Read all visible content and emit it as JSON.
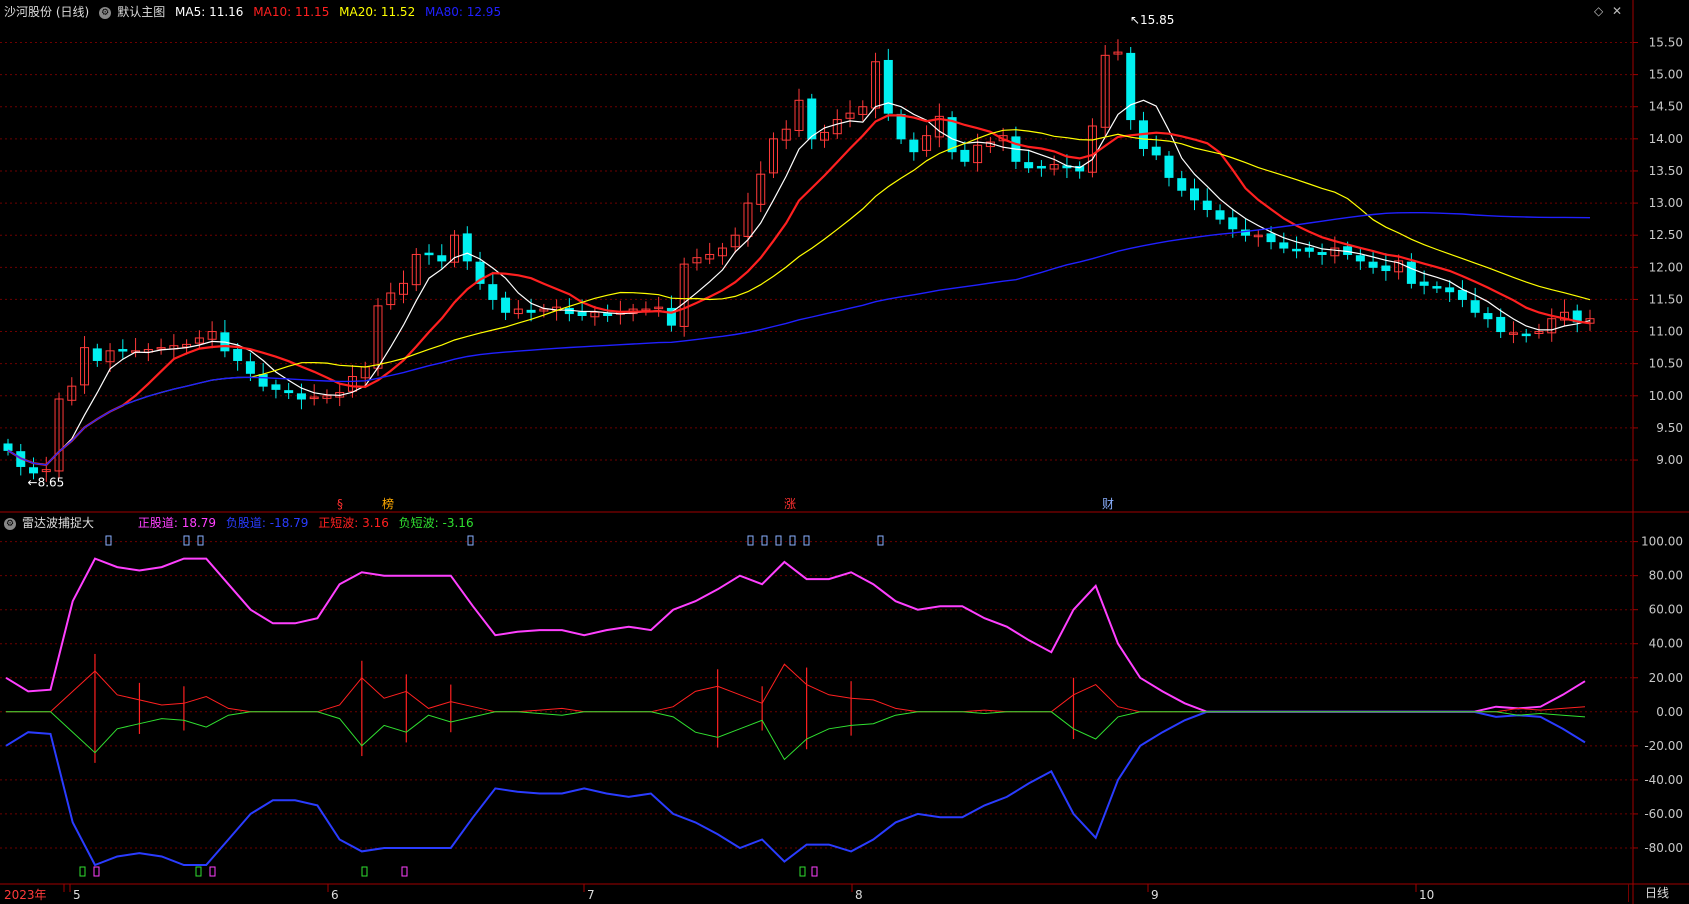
{
  "window": {
    "stock_title": "沙河股份 (日线)",
    "main_indicator": "默认主图",
    "diamond_icon": "diamond-icon",
    "close_icon": "close-icon"
  },
  "ma_legend": [
    {
      "label": "MA5: 11.16",
      "color": "#ffffff"
    },
    {
      "label": "MA10: 11.15",
      "color": "#ff2020"
    },
    {
      "label": "MA20: 11.52",
      "color": "#ffff00"
    },
    {
      "label": "MA80: 12.95",
      "color": "#2020ff"
    }
  ],
  "sub_legend": {
    "title": "雷达波捕捉大",
    "items": [
      {
        "label": "正股道: 18.79",
        "color": "#ff40ff"
      },
      {
        "label": "负股道: -18.79",
        "color": "#2a3cff"
      },
      {
        "label": "正短波: 3.16",
        "color": "#ff2020"
      },
      {
        "label": "负短波: -3.16",
        "color": "#30e030"
      }
    ]
  },
  "period_label": "日线",
  "colors": {
    "up": "#ff3a3a",
    "down": "#00f0f0",
    "grid": "#6e0000",
    "axis_text": "#c8c8c8"
  },
  "chart_data": [
    {
      "type": "candlestick",
      "title": "沙河股份 (日线)",
      "yticks": [
        9.0,
        9.5,
        10.0,
        10.5,
        11.0,
        11.5,
        12.0,
        12.5,
        13.0,
        13.5,
        14.0,
        14.5,
        15.0,
        15.5
      ],
      "ylim": [
        8.3,
        15.85
      ],
      "grid": true,
      "annotations": [
        {
          "text": "15.85",
          "kind": "high"
        },
        {
          "text": "8.65",
          "kind": "low"
        }
      ],
      "event_markers": [
        "§",
        "榜",
        "涨",
        "财"
      ],
      "closes": [
        9.15,
        8.9,
        8.8,
        8.85,
        9.95,
        10.15,
        10.75,
        10.55,
        10.7,
        10.7,
        10.7,
        10.72,
        10.75,
        10.78,
        10.8,
        10.9,
        11.0,
        10.7,
        10.55,
        10.35,
        10.15,
        10.1,
        10.05,
        9.95,
        9.98,
        10.0,
        10.05,
        10.3,
        10.45,
        11.4,
        11.6,
        11.75,
        12.2,
        12.2,
        12.1,
        12.5,
        12.1,
        11.75,
        11.5,
        11.3,
        11.35,
        11.3,
        11.35,
        11.38,
        11.28,
        11.25,
        11.3,
        11.25,
        11.3,
        11.35,
        11.35,
        11.38,
        11.1,
        12.05,
        12.15,
        12.2,
        12.3,
        12.5,
        13.0,
        13.45,
        14.0,
        14.15,
        14.6,
        14.0,
        14.1,
        14.3,
        14.4,
        14.5,
        15.2,
        14.4,
        14.0,
        13.8,
        14.05,
        14.35,
        13.8,
        13.65,
        13.9,
        13.95,
        14.05,
        13.65,
        13.55,
        13.55,
        13.6,
        13.55,
        13.5,
        14.2,
        15.3,
        15.35,
        14.3,
        13.85,
        13.75,
        13.4,
        13.2,
        13.05,
        12.9,
        12.75,
        12.6,
        12.5,
        12.5,
        12.4,
        12.3,
        12.28,
        12.25,
        12.2,
        12.3,
        12.2,
        12.1,
        12.0,
        11.95,
        12.1,
        11.75,
        11.72,
        11.7,
        11.62,
        11.5,
        11.3,
        11.2,
        11.0,
        10.98,
        10.95,
        11.0,
        11.2,
        11.3,
        11.15,
        11.2
      ]
    },
    {
      "type": "line",
      "title": "雷达波捕捉大",
      "yticks": [
        -80,
        -60,
        -40,
        -20,
        0,
        20,
        40,
        60,
        80,
        100
      ],
      "ylim": [
        -100,
        108
      ],
      "grid": true,
      "x_labels": [
        "2023年",
        "5",
        "6",
        "7",
        "8",
        "9",
        "10"
      ],
      "series": [
        {
          "name": "正股道",
          "values": [
            20,
            12,
            13,
            65,
            90,
            85,
            83,
            85,
            90,
            90,
            75,
            60,
            52,
            52,
            55,
            75,
            82,
            80,
            80,
            80,
            80,
            62,
            45,
            47,
            48,
            48,
            45,
            48,
            50,
            48,
            60,
            65,
            72,
            80,
            75,
            88,
            78,
            78,
            82,
            75,
            65,
            60,
            62,
            62,
            55,
            50,
            42,
            35,
            60,
            74,
            40,
            20,
            12,
            5,
            0,
            0,
            0,
            0,
            0,
            0,
            0,
            0,
            0,
            0,
            0,
            0,
            0,
            3,
            2,
            3,
            10,
            18
          ]
        },
        {
          "name": "负股道",
          "values": [
            -20,
            -12,
            -13,
            -65,
            -90,
            -85,
            -83,
            -85,
            -90,
            -90,
            -75,
            -60,
            -52,
            -52,
            -55,
            -75,
            -82,
            -80,
            -80,
            -80,
            -80,
            -62,
            -45,
            -47,
            -48,
            -48,
            -45,
            -48,
            -50,
            -48,
            -60,
            -65,
            -72,
            -80,
            -75,
            -88,
            -78,
            -78,
            -82,
            -75,
            -65,
            -60,
            -62,
            -62,
            -55,
            -50,
            -42,
            -35,
            -60,
            -74,
            -40,
            -20,
            -12,
            -5,
            0,
            0,
            0,
            0,
            0,
            0,
            0,
            0,
            0,
            0,
            0,
            0,
            0,
            -3,
            -2,
            -3,
            -10,
            -18
          ]
        },
        {
          "name": "正短波",
          "values": [
            0,
            0,
            0,
            12,
            24,
            10,
            7,
            4,
            5,
            9,
            2,
            0,
            0,
            0,
            0,
            4,
            20,
            8,
            12,
            2,
            6,
            3,
            0,
            0,
            1,
            2,
            0,
            0,
            0,
            0,
            3,
            12,
            15,
            10,
            5,
            28,
            16,
            10,
            8,
            7,
            2,
            0,
            0,
            0,
            1,
            0,
            0,
            0,
            10,
            16,
            3,
            0,
            0,
            0,
            0,
            0,
            0,
            0,
            0,
            0,
            0,
            0,
            0,
            0,
            0,
            0,
            0,
            0,
            2,
            1,
            2,
            3
          ]
        },
        {
          "name": "负短波",
          "values": [
            0,
            0,
            0,
            -12,
            -24,
            -10,
            -7,
            -4,
            -5,
            -9,
            -2,
            0,
            0,
            0,
            0,
            -4,
            -20,
            -8,
            -12,
            -2,
            -6,
            -3,
            0,
            0,
            -1,
            -2,
            0,
            0,
            0,
            0,
            -3,
            -12,
            -15,
            -10,
            -5,
            -28,
            -16,
            -10,
            -8,
            -7,
            -2,
            0,
            0,
            0,
            -1,
            0,
            0,
            0,
            -10,
            -16,
            -3,
            0,
            0,
            0,
            0,
            0,
            0,
            0,
            0,
            0,
            0,
            0,
            0,
            0,
            0,
            0,
            0,
            0,
            -2,
            -1,
            -2,
            -3
          ]
        }
      ]
    }
  ]
}
